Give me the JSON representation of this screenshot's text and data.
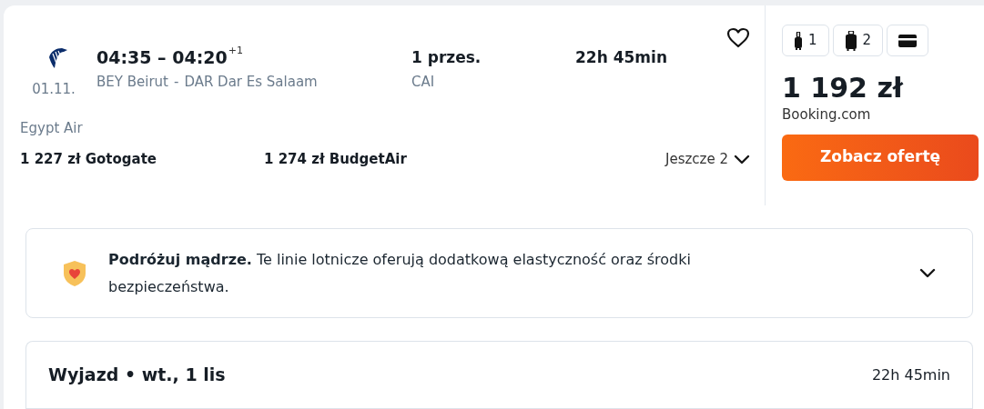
{
  "flight": {
    "date": "01.11.",
    "times": "04:35 – 04:20",
    "day_offset": "+1",
    "route_from": "BEY Beirut",
    "route_sep": "-",
    "route_to": "DAR Dar Es Salaam",
    "stops": "1 przes.",
    "stop_airport": "CAI",
    "duration": "22h 45min",
    "airline": "Egypt Air",
    "favorite": false
  },
  "other_offers": [
    {
      "price": "1 227 zł",
      "provider": "Gotogate"
    },
    {
      "price": "1 274 zł",
      "provider": "BudgetAir"
    }
  ],
  "more_link": {
    "label": "Jeszcze 2",
    "expanded": false
  },
  "bags": [
    {
      "kind": "cabin",
      "count": "1"
    },
    {
      "kind": "checked",
      "count": "2"
    },
    {
      "kind": "card"
    }
  ],
  "price": "1 192 zł",
  "provider": "Booking.com",
  "cta": "Zobacz ofertę",
  "notice": {
    "text": "**Podróżuj mądrze.** Te linie lotnicze oferują dodatkową elastyczność oraz środki bezpieczeństwa.",
    "expanded": false
  },
  "leg": {
    "title": "Wyjazd • wt., 1 lis",
    "duration": "22h 45min"
  }
}
